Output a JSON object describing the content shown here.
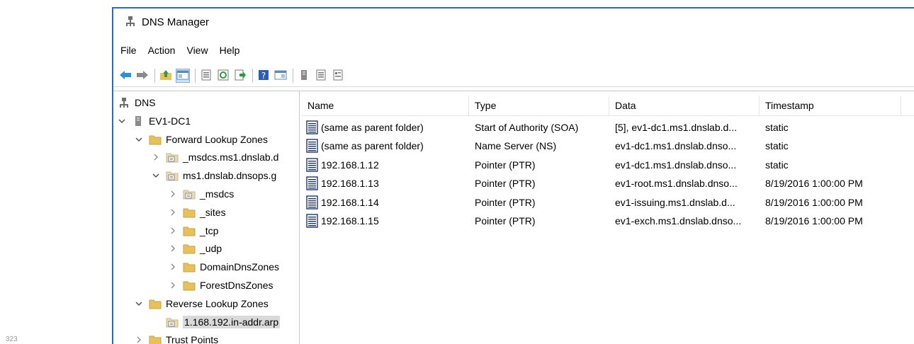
{
  "page_number": "323",
  "window": {
    "title": "DNS Manager"
  },
  "menu": [
    "File",
    "Action",
    "View",
    "Help"
  ],
  "toolbar": {
    "buttons": [
      "back-arrow-icon",
      "forward-arrow-icon",
      "sep",
      "up-folder-icon",
      "show-hide-console-tree-icon",
      "sep",
      "properties-icon",
      "refresh-icon",
      "export-list-icon",
      "sep",
      "help-icon",
      "console-view-icon",
      "sep",
      "server-icon",
      "list-view-icon",
      "document-icon"
    ]
  },
  "tree": {
    "nodes": [
      {
        "label": "DNS",
        "icon": "dns-server-icon",
        "chevron": "",
        "level": 0
      },
      {
        "label": "EV1-DC1",
        "icon": "server-icon",
        "chevron": "down",
        "level": 0
      },
      {
        "label": "Forward Lookup Zones",
        "icon": "folder-icon",
        "chevron": "down",
        "level": 1
      },
      {
        "label": "_msdcs.ms1.dnslab.d",
        "icon": "zone-icon",
        "chevron": "right",
        "level": 2
      },
      {
        "label": "ms1.dnslab.dnsops.g",
        "icon": "zone-icon",
        "chevron": "down",
        "level": 2
      },
      {
        "label": "_msdcs",
        "icon": "zone-icon",
        "chevron": "right",
        "level": 3
      },
      {
        "label": "_sites",
        "icon": "folder-icon",
        "chevron": "right",
        "level": 3
      },
      {
        "label": "_tcp",
        "icon": "folder-icon",
        "chevron": "right",
        "level": 3
      },
      {
        "label": "_udp",
        "icon": "folder-icon",
        "chevron": "right",
        "level": 3
      },
      {
        "label": "DomainDnsZones",
        "icon": "folder-icon",
        "chevron": "right",
        "level": 3
      },
      {
        "label": "ForestDnsZones",
        "icon": "folder-icon",
        "chevron": "right",
        "level": 3
      },
      {
        "label": "Reverse Lookup Zones",
        "icon": "folder-icon",
        "chevron": "down",
        "level": 1
      },
      {
        "label": "1.168.192.in-addr.arp",
        "icon": "zone-icon",
        "chevron": "",
        "level": 2,
        "selected": true
      },
      {
        "label": "Trust Points",
        "icon": "folder-icon",
        "chevron": "right",
        "level": 1
      }
    ]
  },
  "list": {
    "columns": [
      "Name",
      "Type",
      "Data",
      "Timestamp"
    ],
    "rows": [
      [
        "(same as parent folder)",
        "Start of Authority (SOA)",
        "[5], ev1-dc1.ms1.dnslab.d...",
        "static"
      ],
      [
        "(same as parent folder)",
        "Name Server (NS)",
        "ev1-dc1.ms1.dnslab.dnso...",
        "static"
      ],
      [
        "192.168.1.12",
        "Pointer (PTR)",
        "ev1-dc1.ms1.dnslab.dnso...",
        "static"
      ],
      [
        "192.168.1.13",
        "Pointer (PTR)",
        "ev1-root.ms1.dnslab.dnso...",
        "8/19/2016 1:00:00 PM"
      ],
      [
        "192.168.1.14",
        "Pointer (PTR)",
        "ev1-issuing.ms1.dnslab.d...",
        "8/19/2016 1:00:00 PM"
      ],
      [
        "192.168.1.15",
        "Pointer (PTR)",
        "ev1-exch.ms1.dnslab.dnso...",
        "8/19/2016 1:00:00 PM"
      ]
    ]
  },
  "colors": {
    "window_border": "#2b6cb8",
    "folder": "#e8c15a",
    "selection": "#d9d9d9"
  }
}
